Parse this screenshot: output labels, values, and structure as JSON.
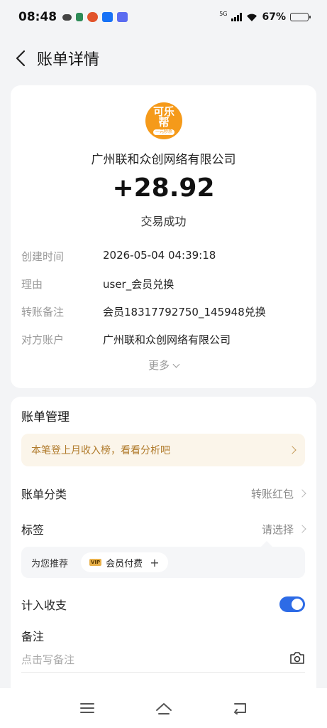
{
  "status_bar": {
    "time": "08:48",
    "network": "5G",
    "battery": "67%",
    "battery_level": 0.67
  },
  "header": {
    "back_icon": "chevron-left-icon",
    "title": "账单详情"
  },
  "summary": {
    "merchant_logo_text": [
      "可乐",
      "帮",
      "一元秒杀"
    ],
    "merchant_name": "广州联和众创网络有限公司",
    "amount": "+28.92",
    "status": "交易成功"
  },
  "details": [
    {
      "label": "创建时间",
      "value": "2026-05-04 04:39:18"
    },
    {
      "label": "理由",
      "value": "user_会员兑换"
    },
    {
      "label": "转账备注",
      "value": "会员18317792750_145948兑换"
    },
    {
      "label": "对方账户",
      "value": "广州联和众创网络有限公司"
    }
  ],
  "more_label": "更多",
  "management": {
    "title": "账单管理",
    "banner_text": "本笔登上月收入榜，看看分析吧",
    "category_label": "账单分类",
    "category_value": "转账红包",
    "tag_label": "标签",
    "tag_value": "请选择",
    "recommend_label": "为您推荐",
    "recommend_chip": "会员付费",
    "vip_badge": "VIP",
    "count_in_label": "计入收支",
    "count_in_enabled": true,
    "note_label": "备注",
    "note_placeholder": "点击写备注"
  },
  "nav_icons": [
    "menu-icon",
    "home-icon",
    "back-icon"
  ],
  "colors": {
    "accent": "#2d6be6",
    "logo": "#f59a1a",
    "banner_bg": "#fbf5ea",
    "banner_text": "#b07a2a"
  }
}
